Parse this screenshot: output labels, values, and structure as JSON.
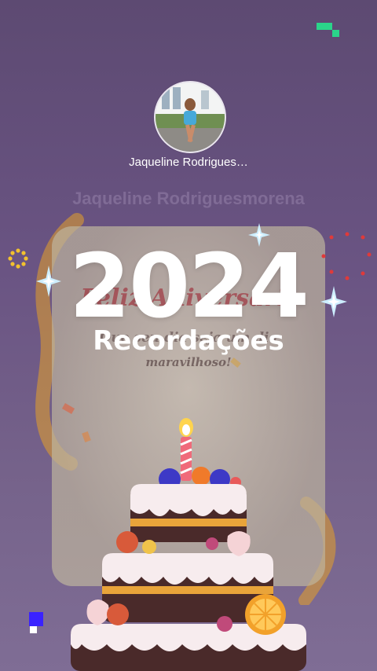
{
  "profile": {
    "name": "Jaqueline Rodrigues…",
    "ghost_name": "Jaqueline Rodriguesmorena"
  },
  "card": {
    "heading": "Feliz Aniversário",
    "line1": "Que seu dia seja um dia",
    "line2": "maravilhoso!"
  },
  "memories": {
    "year": "2024",
    "title": "Recordações"
  },
  "colors": {
    "background": "#6a5483",
    "accent_green": "#2bd48a",
    "accent_blue": "#3a22ff",
    "sparkle": "#bfe8ff",
    "dots_red": "#e03a3a",
    "ring_yellow": "#f2c12e"
  },
  "icons": [
    "sparkle-icon",
    "dot-ring-icon",
    "pixel-square-icon",
    "birthday-cake-icon",
    "avatar-photo"
  ]
}
